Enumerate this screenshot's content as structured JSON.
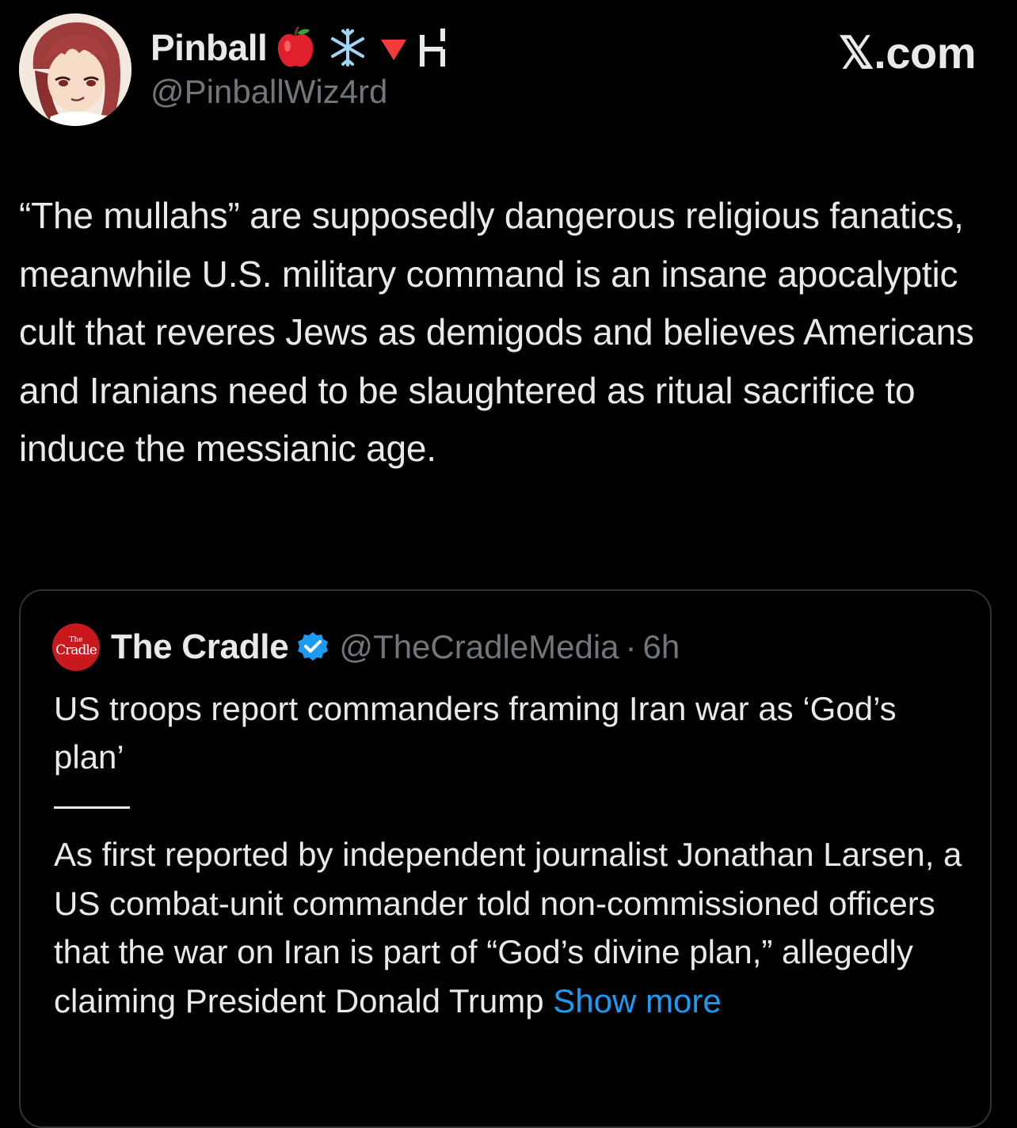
{
  "tweet": {
    "author": {
      "display_name": "Pinball",
      "handle": "@PinballWiz4rd",
      "name_emojis": [
        "red-apple-icon",
        "snowflake-icon",
        "red-triangle-down-icon",
        "h-glyph-icon"
      ]
    },
    "site_brand": "𝕏.com",
    "text": "“The mullahs” are supposedly dangerous religious fanatics, meanwhile U.S. military command is an insane apocalyptic cult that reveres Jews as demigods and believes Americans and Iranians need to be slaughtered as ritual sacrifice to induce the messianic age."
  },
  "quoted_tweet": {
    "author": {
      "display_name": "The Cradle",
      "handle": "@TheCradleMedia",
      "avatar_text_small": "The",
      "avatar_text_big": "Cradle",
      "verified": true
    },
    "separator": "·",
    "time_ago": "6h",
    "headline": "US troops report commanders framing Iran war as ‘God’s plan’",
    "body": "As first reported by independent journalist Jonathan Larsen, a US combat-unit commander told non-commissioned officers that the war on Iran is part of “God’s divine plan,” allegedly claiming President Donald Trump",
    "show_more_label": "Show more"
  },
  "colors": {
    "background": "#000000",
    "text_primary": "#e7e9ea",
    "text_secondary": "#71767b",
    "link": "#1d9bf0",
    "border": "#2f3336",
    "cradle_red": "#c8191c",
    "verified_blue": "#1d9bf0"
  }
}
